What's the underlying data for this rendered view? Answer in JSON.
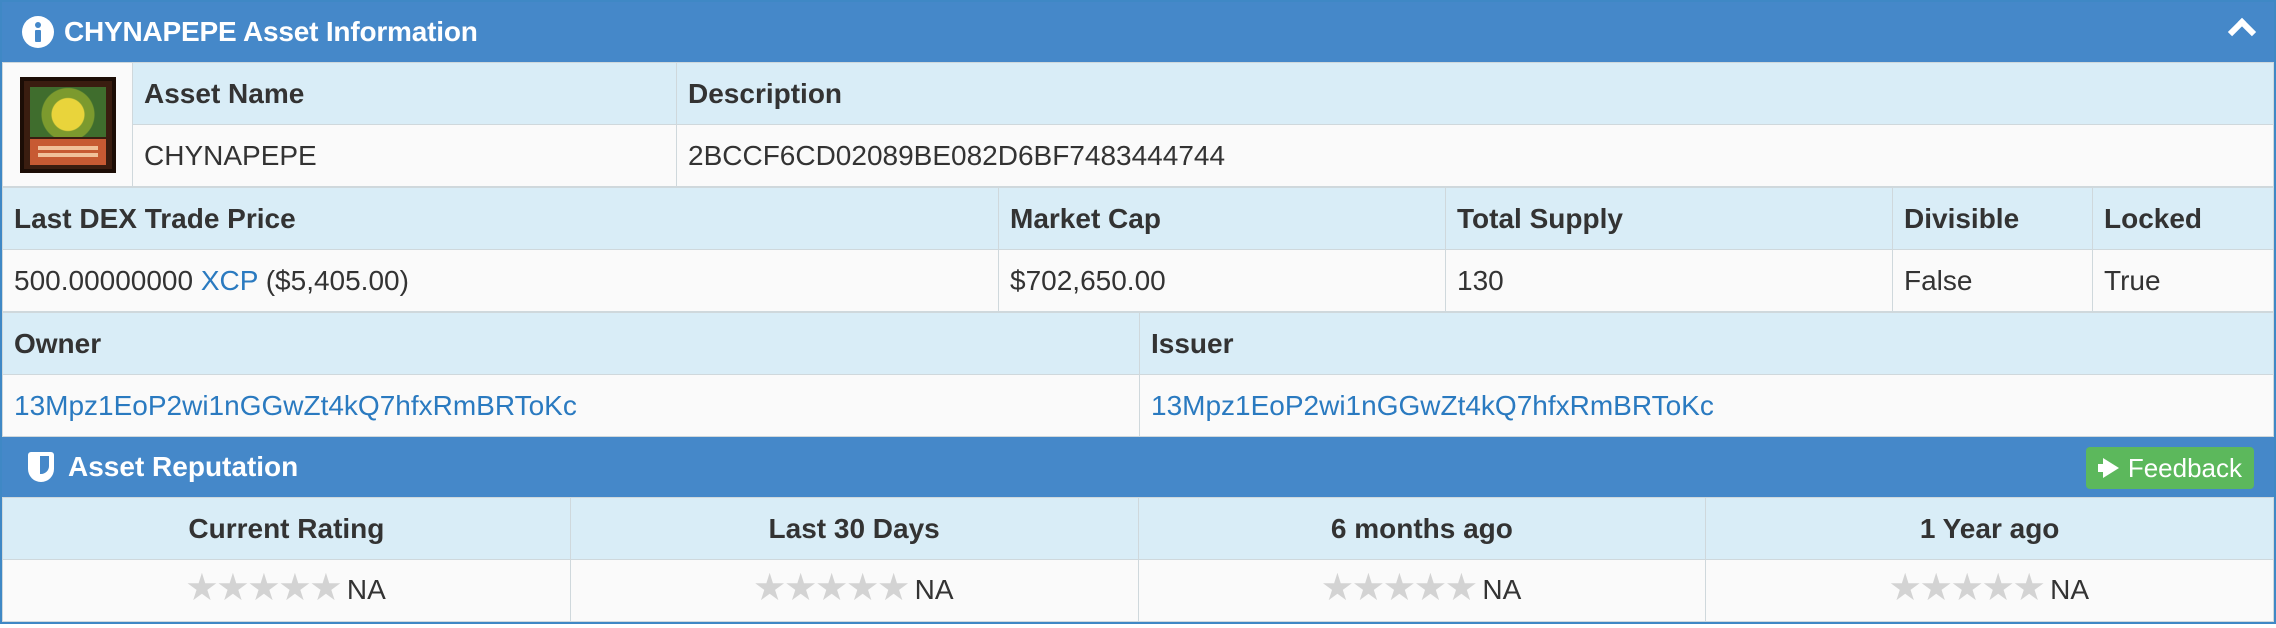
{
  "asset_info": {
    "title": "CHYNAPEPE Asset Information",
    "headers": {
      "asset_name": "Asset Name",
      "description": "Description"
    },
    "asset_name": "CHYNAPEPE",
    "description": "2BCCF6CD02089BE082D6BF7483444744",
    "market_headers": {
      "last_price": "Last DEX Trade Price",
      "market_cap": "Market Cap",
      "total_supply": "Total Supply",
      "divisible": "Divisible",
      "locked": "Locked"
    },
    "last_price_amount": "500.00000000",
    "last_price_currency": "XCP",
    "last_price_usd": "($5,405.00)",
    "market_cap": "$702,650.00",
    "total_supply": "130",
    "divisible": "False",
    "locked": "True",
    "owner_label": "Owner",
    "issuer_label": "Issuer",
    "owner": "13Mpz1EoP2wi1nGGwZt4kQ7hfxRmBRToKc",
    "issuer": "13Mpz1EoP2wi1nGGwZt4kQ7hfxRmBRToKc"
  },
  "reputation": {
    "title": "Asset Reputation",
    "feedback_label": "Feedback",
    "columns": [
      "Current Rating",
      "Last 30 Days",
      "6 months ago",
      "1 Year ago"
    ],
    "ratings": [
      {
        "stars": 0,
        "value": "NA"
      },
      {
        "stars": 0,
        "value": "NA"
      },
      {
        "stars": 0,
        "value": "NA"
      },
      {
        "stars": 0,
        "value": "NA"
      }
    ]
  },
  "colors": {
    "header_blue": "#4588c9",
    "row_header_bg": "#d9edf7",
    "link": "#2a7ac0",
    "feedback_green": "#5cb85c"
  },
  "icons": [
    "info-icon",
    "chevron-up-icon",
    "asset-image",
    "shield-icon",
    "megaphone-icon",
    "star-icon"
  ]
}
